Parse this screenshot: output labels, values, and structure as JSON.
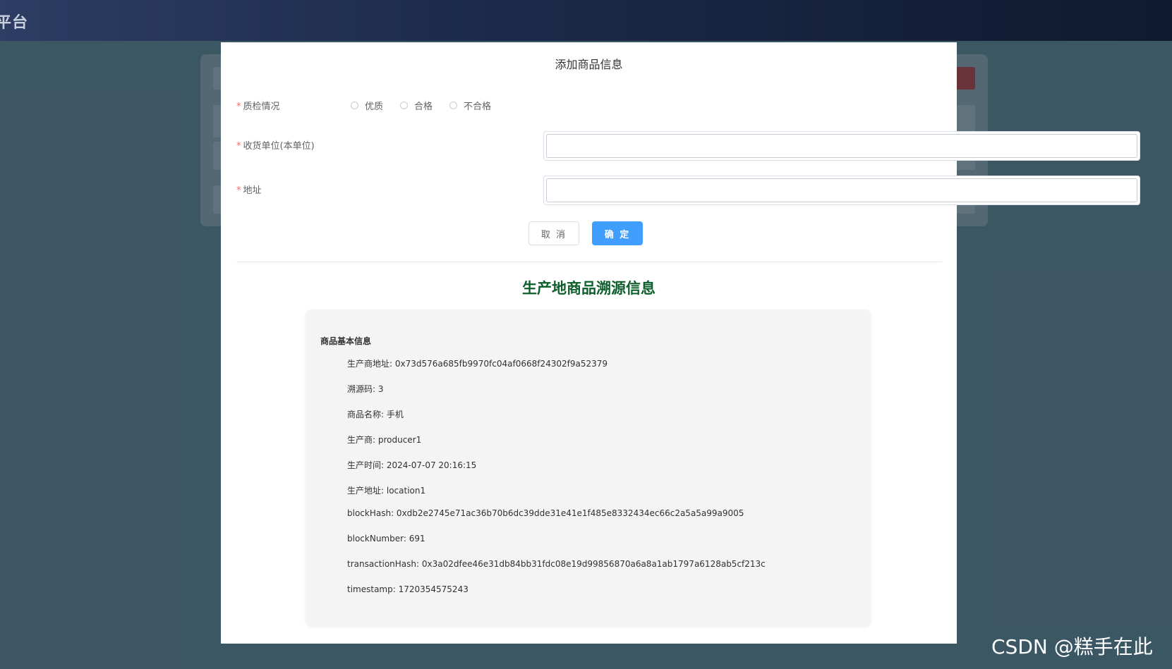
{
  "app": {
    "title": "平台"
  },
  "dialog": {
    "title": "添加商品信息",
    "quality": {
      "label": "质检情况",
      "options": [
        "优质",
        "合格",
        "不合格"
      ]
    },
    "receiver": {
      "label": "收货单位(本单位)",
      "value": ""
    },
    "address": {
      "label": "地址",
      "value": ""
    },
    "cancel_label": "取 消",
    "confirm_label": "确 定"
  },
  "trace": {
    "title": "生产地商品溯源信息",
    "section_title": "商品基本信息",
    "lines": [
      "生产商地址: 0x73d576a685fb9970fc04af0668f24302f9a52379",
      "溯源码: 3",
      "商品名称: 手机",
      "生产商: producer1",
      "生产时间: 2024-07-07 20:16:15",
      "生产地址: location1",
      "blockHash: 0xdb2e2745e71ac36b70b6dc39dde31e41e1f485e8332434ec66c2a5a5a99a9005",
      "blockNumber: 691",
      "transactionHash: 0x3a02dfee46e31db84bb31fdc08e19d99856870a6a8a1ab1797a6128ab5cf213c",
      "timestamp: 1720354575243"
    ]
  },
  "watermark": "CSDN @糕手在此",
  "colors": {
    "primary": "#409eff",
    "required": "#f56c6c",
    "trace_title": "#0d5e2b",
    "overlay": "#466470"
  }
}
